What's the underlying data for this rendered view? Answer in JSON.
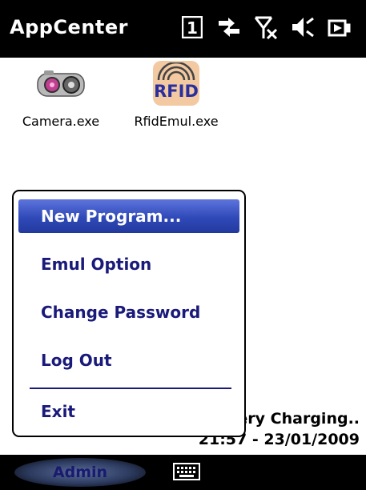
{
  "titlebar": {
    "app_title": "AppCenter",
    "status_icons": [
      "connectivity-icon",
      "data-sync-icon",
      "no-signal-icon",
      "volume-muted-icon",
      "battery-charging-icon"
    ],
    "connectivity_number": "1"
  },
  "desktop": {
    "icons": [
      {
        "label": "Camera.exe",
        "icon": "camera-icon"
      },
      {
        "label": "RfidEmul.exe",
        "icon": "rfid-icon",
        "icon_text": "RFID"
      }
    ],
    "status_line1": "ery Charging..",
    "status_line2": "21:57 - 23/01/2009"
  },
  "menu": {
    "items": [
      {
        "label": "New Program...",
        "selected": true
      },
      {
        "label": "Emul Option"
      },
      {
        "label": "Change Password"
      },
      {
        "label": "Log Out"
      },
      {
        "label": "Exit"
      }
    ]
  },
  "softbar": {
    "left_label": "Admin",
    "keyboard_icon": "keyboard-icon"
  },
  "colors": {
    "menu_text": "#1a1a7a",
    "selection": "#2f49b8",
    "bars": "#000000"
  }
}
